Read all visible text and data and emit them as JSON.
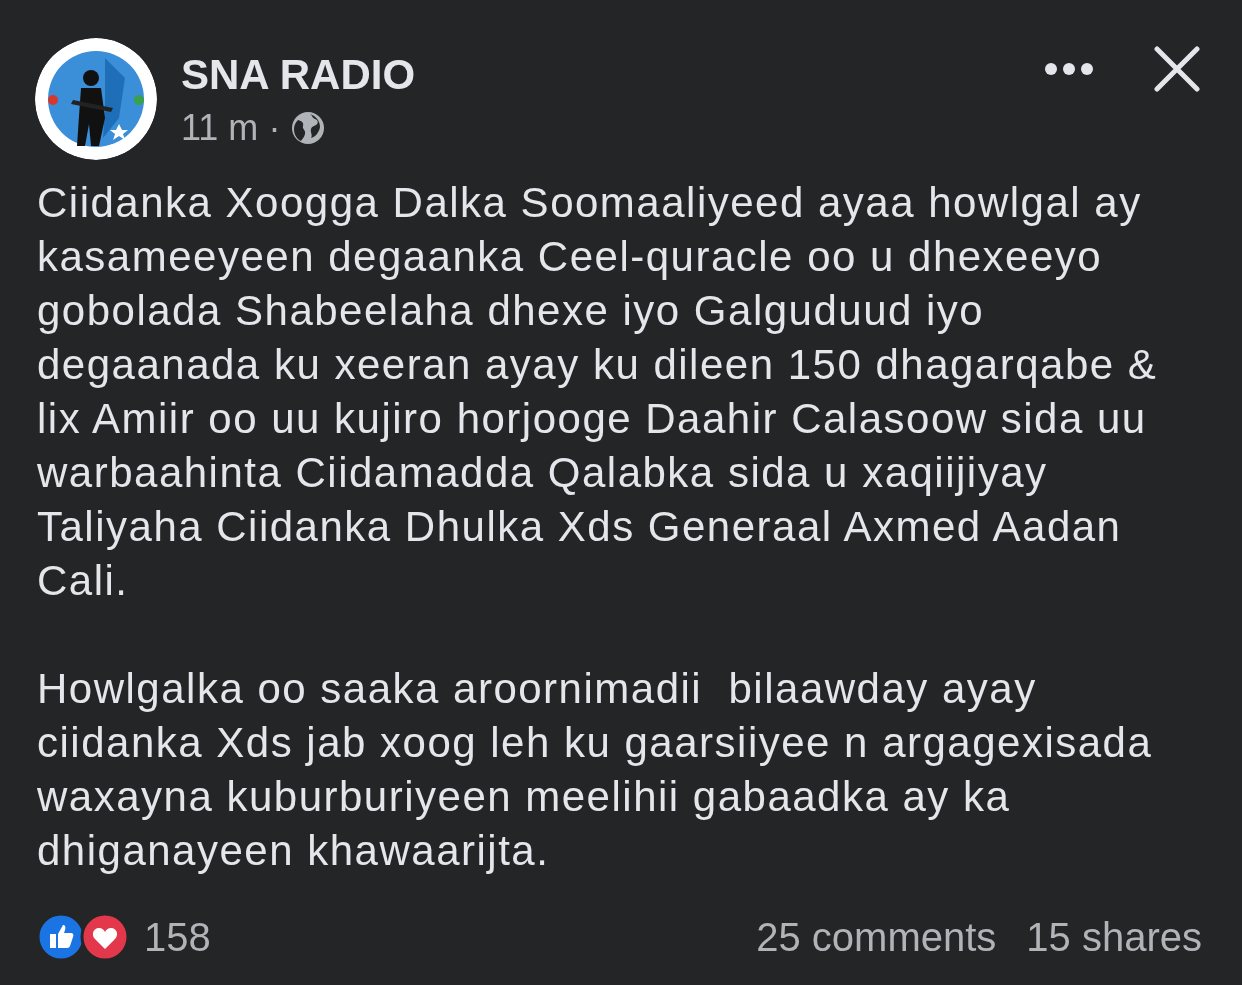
{
  "post": {
    "author": "SNA RADIO",
    "time": "11 m",
    "separator": "·",
    "paragraphs": [
      "Ciidanka Xoogga Dalka Soomaaliyeed ayaa howlgal ay kasameeyeen degaanka Ceel-quracle oo u dhexeeyo gobolada Shabeelaha dhexe iyo Galguduud iyo degaanada ku xeeran ayay ku dileen 150 dhagarqabe & lix Amiir oo uu kujiro horjooge Daahir Calasoow sida uu warbaahinta Ciidamadda Qalabka sida u xaqiijiyay Taliyaha Ciidanka Dhulka Xds Generaal Axmed Aadan Cali.",
      "Howlgalka oo saaka aroornimadii  bilaawday ayay ciidanka Xds jab xoog leh ku gaarsiiyee n argagexisada waxayna kuburburiyeen meelihii gabaadka ay ka dhiganayeen khawaarijta."
    ],
    "reactions": [
      {
        "kind": "like"
      },
      {
        "kind": "love"
      }
    ],
    "reaction_count": "158",
    "comments": "25 comments",
    "shares": "15 shares"
  }
}
